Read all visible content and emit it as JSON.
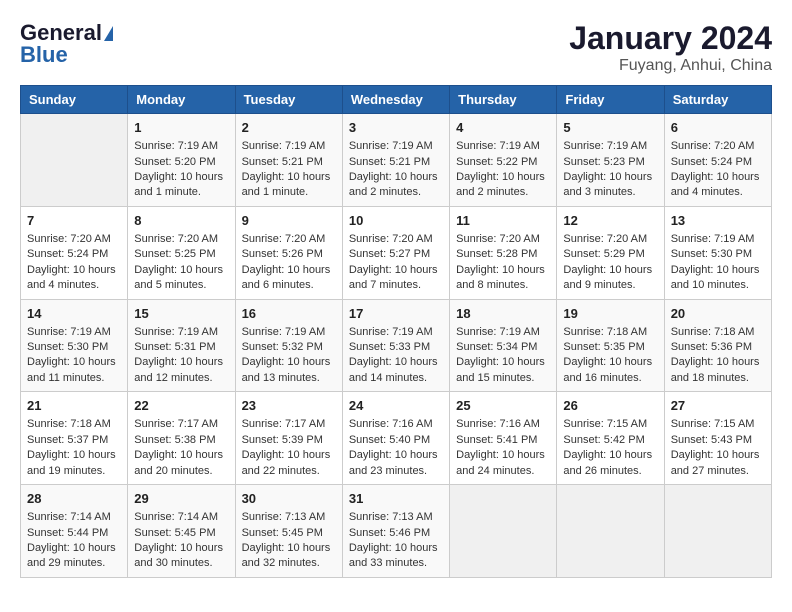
{
  "logo": {
    "general": "General",
    "blue": "Blue",
    "arrow": "▶"
  },
  "title": "January 2024",
  "subtitle": "Fuyang, Anhui, China",
  "headers": [
    "Sunday",
    "Monday",
    "Tuesday",
    "Wednesday",
    "Thursday",
    "Friday",
    "Saturday"
  ],
  "weeks": [
    [
      {
        "day": "",
        "lines": []
      },
      {
        "day": "1",
        "lines": [
          "Sunrise: 7:19 AM",
          "Sunset: 5:20 PM",
          "Daylight: 10 hours",
          "and 1 minute."
        ]
      },
      {
        "day": "2",
        "lines": [
          "Sunrise: 7:19 AM",
          "Sunset: 5:21 PM",
          "Daylight: 10 hours",
          "and 1 minute."
        ]
      },
      {
        "day": "3",
        "lines": [
          "Sunrise: 7:19 AM",
          "Sunset: 5:21 PM",
          "Daylight: 10 hours",
          "and 2 minutes."
        ]
      },
      {
        "day": "4",
        "lines": [
          "Sunrise: 7:19 AM",
          "Sunset: 5:22 PM",
          "Daylight: 10 hours",
          "and 2 minutes."
        ]
      },
      {
        "day": "5",
        "lines": [
          "Sunrise: 7:19 AM",
          "Sunset: 5:23 PM",
          "Daylight: 10 hours",
          "and 3 minutes."
        ]
      },
      {
        "day": "6",
        "lines": [
          "Sunrise: 7:20 AM",
          "Sunset: 5:24 PM",
          "Daylight: 10 hours",
          "and 4 minutes."
        ]
      }
    ],
    [
      {
        "day": "7",
        "lines": [
          "Sunrise: 7:20 AM",
          "Sunset: 5:24 PM",
          "Daylight: 10 hours",
          "and 4 minutes."
        ]
      },
      {
        "day": "8",
        "lines": [
          "Sunrise: 7:20 AM",
          "Sunset: 5:25 PM",
          "Daylight: 10 hours",
          "and 5 minutes."
        ]
      },
      {
        "day": "9",
        "lines": [
          "Sunrise: 7:20 AM",
          "Sunset: 5:26 PM",
          "Daylight: 10 hours",
          "and 6 minutes."
        ]
      },
      {
        "day": "10",
        "lines": [
          "Sunrise: 7:20 AM",
          "Sunset: 5:27 PM",
          "Daylight: 10 hours",
          "and 7 minutes."
        ]
      },
      {
        "day": "11",
        "lines": [
          "Sunrise: 7:20 AM",
          "Sunset: 5:28 PM",
          "Daylight: 10 hours",
          "and 8 minutes."
        ]
      },
      {
        "day": "12",
        "lines": [
          "Sunrise: 7:20 AM",
          "Sunset: 5:29 PM",
          "Daylight: 10 hours",
          "and 9 minutes."
        ]
      },
      {
        "day": "13",
        "lines": [
          "Sunrise: 7:19 AM",
          "Sunset: 5:30 PM",
          "Daylight: 10 hours",
          "and 10 minutes."
        ]
      }
    ],
    [
      {
        "day": "14",
        "lines": [
          "Sunrise: 7:19 AM",
          "Sunset: 5:30 PM",
          "Daylight: 10 hours",
          "and 11 minutes."
        ]
      },
      {
        "day": "15",
        "lines": [
          "Sunrise: 7:19 AM",
          "Sunset: 5:31 PM",
          "Daylight: 10 hours",
          "and 12 minutes."
        ]
      },
      {
        "day": "16",
        "lines": [
          "Sunrise: 7:19 AM",
          "Sunset: 5:32 PM",
          "Daylight: 10 hours",
          "and 13 minutes."
        ]
      },
      {
        "day": "17",
        "lines": [
          "Sunrise: 7:19 AM",
          "Sunset: 5:33 PM",
          "Daylight: 10 hours",
          "and 14 minutes."
        ]
      },
      {
        "day": "18",
        "lines": [
          "Sunrise: 7:19 AM",
          "Sunset: 5:34 PM",
          "Daylight: 10 hours",
          "and 15 minutes."
        ]
      },
      {
        "day": "19",
        "lines": [
          "Sunrise: 7:18 AM",
          "Sunset: 5:35 PM",
          "Daylight: 10 hours",
          "and 16 minutes."
        ]
      },
      {
        "day": "20",
        "lines": [
          "Sunrise: 7:18 AM",
          "Sunset: 5:36 PM",
          "Daylight: 10 hours",
          "and 18 minutes."
        ]
      }
    ],
    [
      {
        "day": "21",
        "lines": [
          "Sunrise: 7:18 AM",
          "Sunset: 5:37 PM",
          "Daylight: 10 hours",
          "and 19 minutes."
        ]
      },
      {
        "day": "22",
        "lines": [
          "Sunrise: 7:17 AM",
          "Sunset: 5:38 PM",
          "Daylight: 10 hours",
          "and 20 minutes."
        ]
      },
      {
        "day": "23",
        "lines": [
          "Sunrise: 7:17 AM",
          "Sunset: 5:39 PM",
          "Daylight: 10 hours",
          "and 22 minutes."
        ]
      },
      {
        "day": "24",
        "lines": [
          "Sunrise: 7:16 AM",
          "Sunset: 5:40 PM",
          "Daylight: 10 hours",
          "and 23 minutes."
        ]
      },
      {
        "day": "25",
        "lines": [
          "Sunrise: 7:16 AM",
          "Sunset: 5:41 PM",
          "Daylight: 10 hours",
          "and 24 minutes."
        ]
      },
      {
        "day": "26",
        "lines": [
          "Sunrise: 7:15 AM",
          "Sunset: 5:42 PM",
          "Daylight: 10 hours",
          "and 26 minutes."
        ]
      },
      {
        "day": "27",
        "lines": [
          "Sunrise: 7:15 AM",
          "Sunset: 5:43 PM",
          "Daylight: 10 hours",
          "and 27 minutes."
        ]
      }
    ],
    [
      {
        "day": "28",
        "lines": [
          "Sunrise: 7:14 AM",
          "Sunset: 5:44 PM",
          "Daylight: 10 hours",
          "and 29 minutes."
        ]
      },
      {
        "day": "29",
        "lines": [
          "Sunrise: 7:14 AM",
          "Sunset: 5:45 PM",
          "Daylight: 10 hours",
          "and 30 minutes."
        ]
      },
      {
        "day": "30",
        "lines": [
          "Sunrise: 7:13 AM",
          "Sunset: 5:45 PM",
          "Daylight: 10 hours",
          "and 32 minutes."
        ]
      },
      {
        "day": "31",
        "lines": [
          "Sunrise: 7:13 AM",
          "Sunset: 5:46 PM",
          "Daylight: 10 hours",
          "and 33 minutes."
        ]
      },
      {
        "day": "",
        "lines": []
      },
      {
        "day": "",
        "lines": []
      },
      {
        "day": "",
        "lines": []
      }
    ]
  ]
}
